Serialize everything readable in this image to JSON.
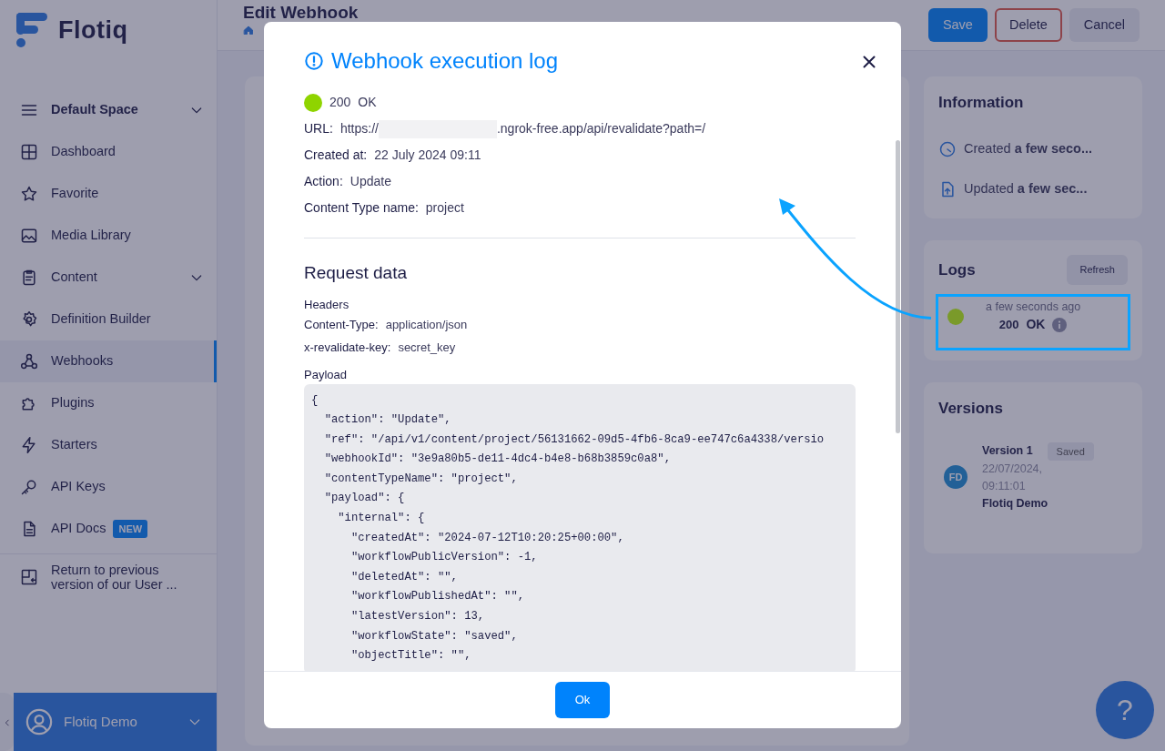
{
  "app": {
    "logo": "Flotiq"
  },
  "sidebar": {
    "items": [
      {
        "label": "Default Space",
        "kind": "space",
        "selected": false
      },
      {
        "label": "Dashboard",
        "kind": "link",
        "selected": false
      },
      {
        "label": "Favorite",
        "kind": "link",
        "selected": false
      },
      {
        "label": "Media Library",
        "kind": "link",
        "selected": false
      },
      {
        "label": "Content",
        "kind": "group",
        "selected": false
      },
      {
        "label": "Definition Builder",
        "kind": "link",
        "selected": false
      },
      {
        "label": "Webhooks",
        "kind": "link",
        "selected": true
      },
      {
        "label": "Plugins",
        "kind": "link",
        "selected": false
      },
      {
        "label": "Starters",
        "kind": "link",
        "selected": false
      },
      {
        "label": "API Keys",
        "kind": "link",
        "selected": false
      },
      {
        "label": "API Docs",
        "kind": "link",
        "selected": false,
        "badge": "NEW"
      }
    ],
    "return_link": "Return to previous version of our User ...",
    "user": "Flotiq Demo"
  },
  "header": {
    "title": "Edit Webhook",
    "buttons": [
      {
        "label": "Save",
        "kind": "primary"
      },
      {
        "label": "Delete",
        "kind": "danger"
      },
      {
        "label": "Cancel",
        "kind": "secondary"
      }
    ]
  },
  "information": {
    "title": "Information",
    "rows": [
      "Created **a few seco...**",
      "Updated **a few sec...**"
    ]
  },
  "logs": {
    "title": "Logs",
    "refresh": "Refresh",
    "entries": [
      {
        "time": "a few seconds ago",
        "code": "200",
        "status": "OK",
        "color": "#7a9a2a",
        "highlighted": true
      }
    ]
  },
  "versions": {
    "title": "Versions",
    "entries": [
      {
        "avatar": "FD",
        "version": "Version 1",
        "badge": "Saved",
        "date": "22/07/2024,",
        "time": "09:11:01",
        "author": "Flotiq Demo"
      }
    ]
  },
  "modal": {
    "title": "Webhook execution log",
    "status": {
      "code": "200",
      "text": "OK",
      "color": "#8fd400"
    },
    "details": [
      {
        "kind": "url",
        "label": "URL:",
        "prefix": "https://",
        "suffix": ".ngrok-free.app/api/revalidate?path=/"
      },
      {
        "kind": "text",
        "label": "Created at:",
        "value": "22 July 2024 09:11"
      },
      {
        "kind": "text",
        "label": "Action:",
        "value": "Update"
      },
      {
        "kind": "text",
        "label": "Content Type name:",
        "value": "project"
      }
    ],
    "section": "Request data",
    "headers_label": "Headers",
    "headers": [
      {
        "key": "Content-Type:",
        "value": "application/json"
      },
      {
        "key": "x-revalidate-key:",
        "value": "secret_key"
      }
    ],
    "payload_label": "Payload",
    "payload": [
      "{",
      "  \"action\": \"Update\",",
      "  \"ref\": \"/api/v1/content/project/56131662-09d5-4fb6-8ca9-ee747c6a4338/versio",
      "  \"webhookId\": \"3e9a80b5-de11-4dc4-b4e8-b68b3859c0a8\",",
      "  \"contentTypeName\": \"project\",",
      "  \"payload\": {",
      "    \"internal\": {",
      "      \"createdAt\": \"2024-07-12T10:20:25+00:00\",",
      "      \"workflowPublicVersion\": -1,",
      "      \"deletedAt\": \"\",",
      "      \"workflowPublishedAt\": \"\",",
      "      \"latestVersion\": 13,",
      "      \"workflowState\": \"saved\",",
      "      \"objectTitle\": \"\","
    ],
    "ok_button": "Ok"
  },
  "help": "?"
}
